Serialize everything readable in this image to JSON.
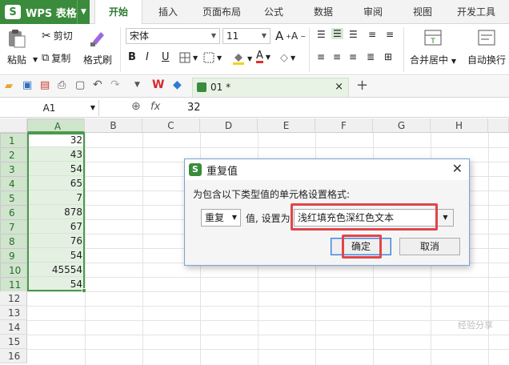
{
  "app": {
    "name": "WPS 表格",
    "logo_letter": "S",
    "accent": "#3a8b3c"
  },
  "tabs": [
    {
      "label": "开始",
      "active": true
    },
    {
      "label": "插入"
    },
    {
      "label": "页面布局"
    },
    {
      "label": "公式"
    },
    {
      "label": "数据"
    },
    {
      "label": "审阅"
    },
    {
      "label": "视图"
    },
    {
      "label": "开发工具"
    }
  ],
  "ribbon": {
    "paste": "粘贴",
    "cut": "剪切",
    "copy": "复制",
    "format_painter": "格式刷",
    "font_name": "宋体",
    "font_size": "11",
    "bold": "B",
    "italic": "I",
    "underline": "U",
    "grow_font": "A",
    "shrink_font": "A",
    "merge_center": "合并居中",
    "wrap_text": "自动换行"
  },
  "document_tab": {
    "name": "01 *"
  },
  "formula_bar": {
    "cell_ref": "A1",
    "fx": "fx",
    "value": "32"
  },
  "grid": {
    "columns": [
      "A",
      "B",
      "C",
      "D",
      "E",
      "F",
      "G",
      "H"
    ],
    "rows": [
      "1",
      "2",
      "3",
      "4",
      "5",
      "6",
      "7",
      "8",
      "9",
      "10",
      "11",
      "12",
      "13",
      "14",
      "15",
      "16"
    ],
    "col_a_values": [
      "32",
      "43",
      "54",
      "65",
      "7",
      "878",
      "67",
      "76",
      "54",
      "45554",
      "54"
    ]
  },
  "dialog": {
    "title": "重复值",
    "logo_letter": "S",
    "description": "为包含以下类型值的单元格设置格式:",
    "type_select": "重复",
    "value_label": "值, 设置为",
    "format_select": "浅红填充色深红色文本",
    "ok": "确定",
    "cancel": "取消"
  },
  "watermark": "经验分享"
}
